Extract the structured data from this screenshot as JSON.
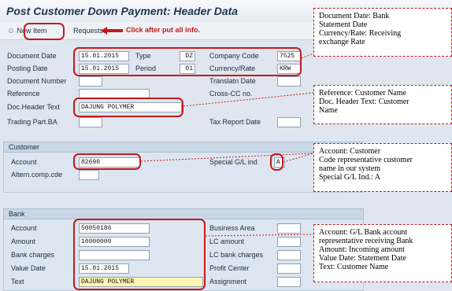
{
  "title": "Post Customer Down Payment: Header Data",
  "toolbar": {
    "new_item": "New Item",
    "requests": "Requests",
    "hint": "Click after put all info."
  },
  "header": {
    "document_date_label": "Document Date",
    "document_date": "15.01.2015",
    "type_label": "Type",
    "type": "DZ",
    "company_code_label": "Company Code",
    "company_code": "7525",
    "posting_date_label": "Posting Date",
    "posting_date": "15.01.2015",
    "period_label": "Period",
    "period": "01",
    "currency_label": "Currency/Rate",
    "currency": "KRW",
    "document_number_label": "Document Number",
    "translatn_date_label": "Translatn Date",
    "reference_label": "Reference",
    "cross_cc_label": "Cross-CC no.",
    "doc_header_text_label": "Doc.Header Text",
    "doc_header_text": "DAJUNG POLYMER",
    "trading_part_label": "Trading Part.BA",
    "tax_report_label": "Tax Report Date"
  },
  "customer": {
    "section_label": "Customer",
    "account_label": "Account",
    "account": "82690",
    "altern_label": "Altern.comp.cde",
    "special_gl_label": "Special G/L ind",
    "special_gl": "A"
  },
  "bank": {
    "section_label": "Bank",
    "account_label": "Account",
    "account": "50050186",
    "amount_label": "Amount",
    "amount": "10000000",
    "bank_charges_label": "Bank charges",
    "value_date_label": "Value Date",
    "value_date": "15.01.2015",
    "text_label": "Text",
    "text": "DAJUNG POLYMER",
    "business_area_label": "Business Area",
    "lc_amount_label": "LC amount",
    "lc_bank_charges_label": "LC bank charges",
    "profit_center_label": "Profit Center",
    "assignment_label": "Assignment"
  },
  "notes": {
    "note1": [
      "Document Date: Bank",
      "Statement Date",
      "Currency/Rate: Receiving",
      "exchange Rate"
    ],
    "note2": [
      "Reference: Customer Name",
      "Doc. Header Text: Customer",
      "Name"
    ],
    "note3": [
      "Account: Customer",
      " Code representative customer",
      "name in our system",
      "Special G/L Ind.: A"
    ],
    "note4": [
      "Account: G/L Bank account",
      "representative receiving Bank",
      "Amount: Incoming amount",
      "Value Date: Statement Date",
      "Text: Customer Name"
    ]
  },
  "colors": {
    "accent_red": "#c41a1a",
    "section_header": "#c9d7e6",
    "background": "#dfe6ef"
  },
  "icons": {
    "new_item": "person-icon",
    "hint_arrow": "left-arrow-icon"
  }
}
